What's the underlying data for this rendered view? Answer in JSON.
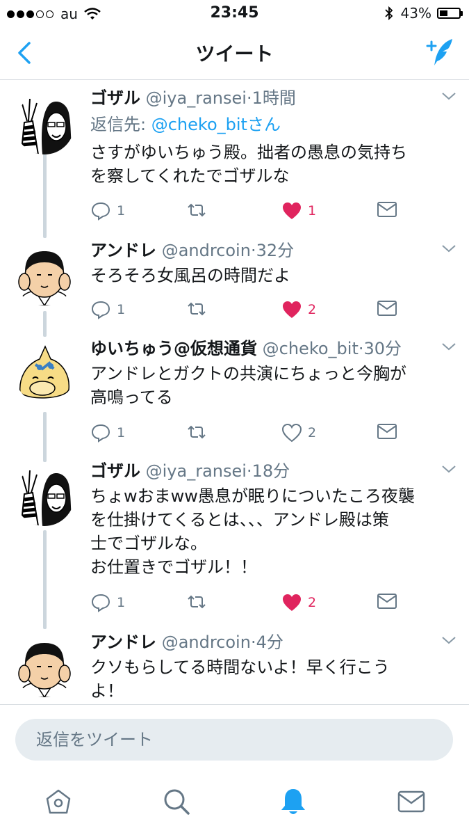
{
  "status_bar": {
    "carrier": "au",
    "time": "23:45",
    "battery": "43%",
    "battery_level": 0.43
  },
  "nav": {
    "title": "ツイート"
  },
  "tweets": [
    {
      "name": "ゴザル",
      "handle": "@iya_ransei",
      "time": "1時間",
      "reply_to_label": "返信先:",
      "reply_to_user": "@cheko_bitさん",
      "text": "さすがゆいちゅう殿。拙者の愚息の気持ち\nを察してくれたでゴザルな",
      "replies": "1",
      "likes": "1",
      "liked": true
    },
    {
      "name": "アンドレ",
      "handle": "@andrcoin",
      "time": "32分",
      "text": "そろそろ女風呂の時間だよ",
      "replies": "1",
      "likes": "2",
      "liked": true
    },
    {
      "name": "ゆいちゅう@仮想通貨",
      "handle": "@cheko_bit",
      "time": "30分",
      "text": "アンドレとガクトの共演にちょっと今胸が\n高鳴ってる",
      "replies": "1",
      "likes": "2",
      "liked": false
    },
    {
      "name": "ゴザル",
      "handle": "@iya_ransei",
      "time": "18分",
      "text": "ちょwおまww愚息が眠りについたころ夜襲\nを仕掛けてくるとは、、、アンドレ殿は策\n士でゴザルな。\nお仕置きでゴザル！！",
      "replies": "1",
      "likes": "2",
      "liked": true
    },
    {
      "name": "アンドレ",
      "handle": "@andrcoin",
      "time": "4分",
      "text": "クソもらしてる時間ないよ！早く行こう\nよ！"
    }
  ],
  "reply_box": {
    "placeholder": "返信をツイート"
  },
  "tabs": [
    "home",
    "search",
    "notifications",
    "messages"
  ],
  "icons": {
    "back": "chevron-left-icon",
    "compose": "compose-tweet-icon",
    "reply": "reply-icon",
    "retweet": "retweet-icon",
    "like": "heart-icon",
    "dm": "envelope-icon",
    "caret": "chevron-down-icon"
  },
  "colors": {
    "accent": "#1da1f2",
    "like": "#e0245e",
    "muted": "#657786",
    "thread": "#ccd6dd"
  }
}
